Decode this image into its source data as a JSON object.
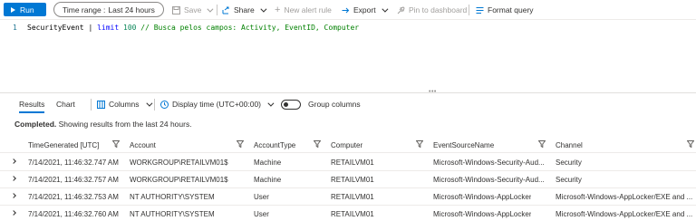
{
  "toolbar": {
    "run_label": "Run",
    "time_range_label": "Time range :",
    "time_range_value": "Last 24 hours",
    "save_label": "Save",
    "share_label": "Share",
    "new_alert_label": "New alert rule",
    "export_label": "Export",
    "pin_label": "Pin to dashboard",
    "format_label": "Format query"
  },
  "editor": {
    "line_number": "1",
    "table": "SecurityEvent",
    "pipe": " | ",
    "op": "limit",
    "space": " ",
    "num": "100",
    "comment": " // Busca pelos campos: Activity, EventID, Computer"
  },
  "results_bar": {
    "tab_results": "Results",
    "tab_chart": "Chart",
    "columns_label": "Columns",
    "display_time_label": "Display time (UTC+00:00)",
    "group_columns_label": "Group columns"
  },
  "status": {
    "bold": "Completed.",
    "text": " Showing results from the last 24 hours."
  },
  "table": {
    "headers": [
      "TimeGenerated [UTC]",
      "Account",
      "AccountType",
      "Computer",
      "EventSourceName",
      "Channel"
    ],
    "rows": [
      [
        "7/14/2021, 11:46:32.747 AM",
        "WORKGROUP\\RETAILVM01$",
        "Machine",
        "RETAILVM01",
        "Microsoft-Windows-Security-Aud...",
        "Security"
      ],
      [
        "7/14/2021, 11:46:32.757 AM",
        "WORKGROUP\\RETAILVM01$",
        "Machine",
        "RETAILVM01",
        "Microsoft-Windows-Security-Aud...",
        "Security"
      ],
      [
        "7/14/2021, 11:46:32.753 AM",
        "NT AUTHORITY\\SYSTEM",
        "User",
        "RETAILVM01",
        "Microsoft-Windows-AppLocker",
        "Microsoft-Windows-AppLocker/EXE and ..."
      ],
      [
        "7/14/2021, 11:46:32.760 AM",
        "NT AUTHORITY\\SYSTEM",
        "User",
        "RETAILVM01",
        "Microsoft-Windows-AppLocker",
        "Microsoft-Windows-AppLocker/EXE and ..."
      ]
    ]
  }
}
